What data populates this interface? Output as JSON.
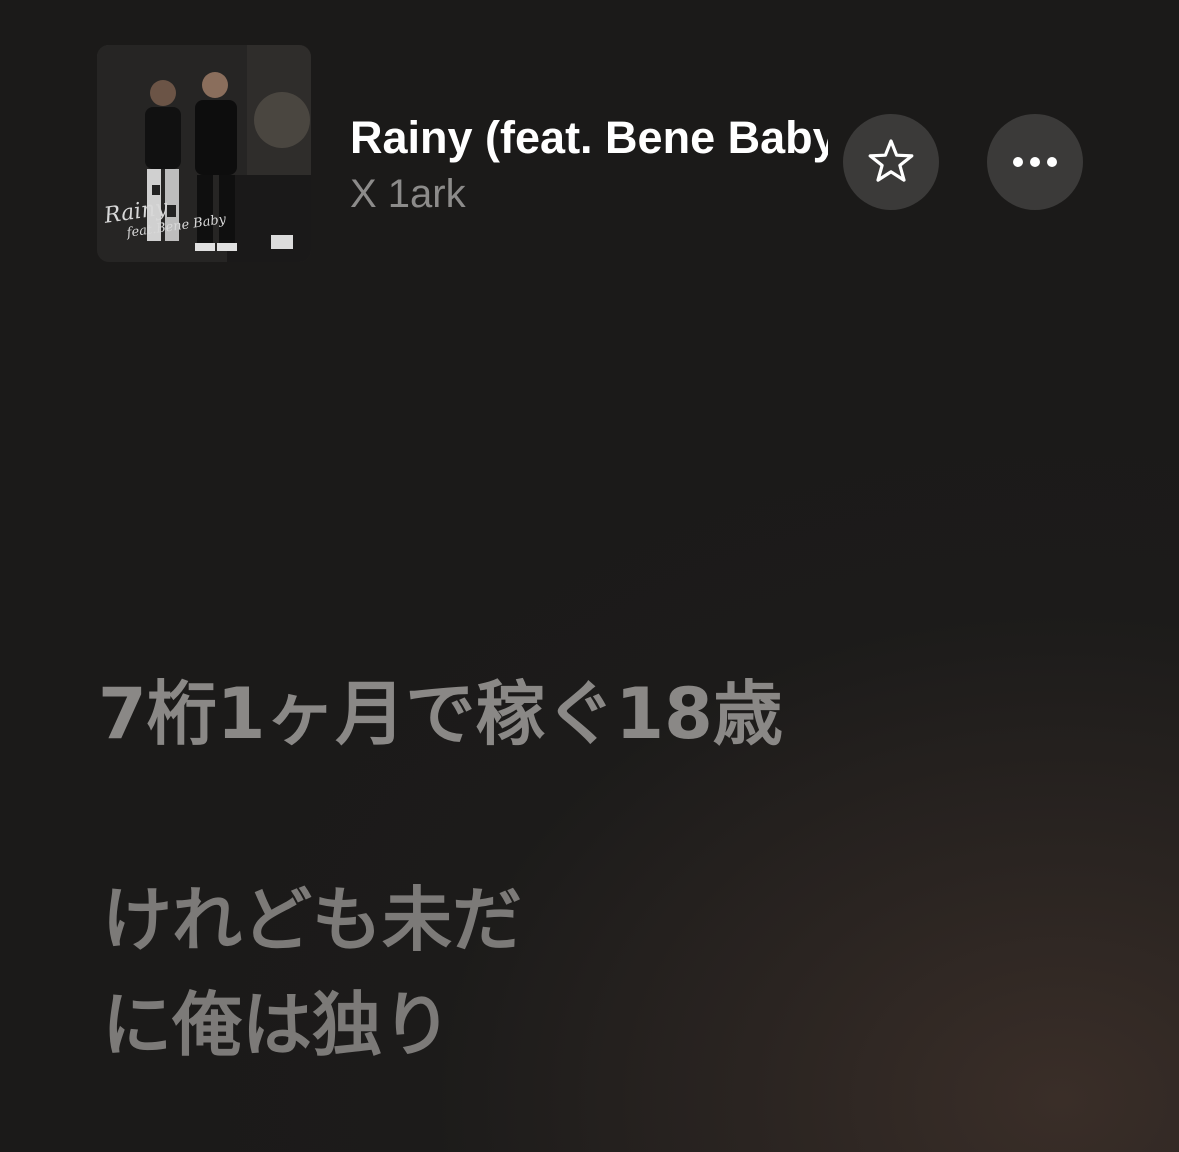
{
  "now_playing": {
    "title": "Rainy (feat. Bene Baby)",
    "artist": "X 1ark",
    "artwork": {
      "caption_main": "Rainy",
      "caption_sub": "feat.Bene Baby"
    }
  },
  "actions": {
    "favorite_icon": "star-outline-icon",
    "more_icon": "ellipsis-icon"
  },
  "lyrics": {
    "line_1": "7桁1ヶ月で稼ぐ18歳",
    "line_2a": "けれども未だ",
    "line_2b": "に俺は独り"
  }
}
